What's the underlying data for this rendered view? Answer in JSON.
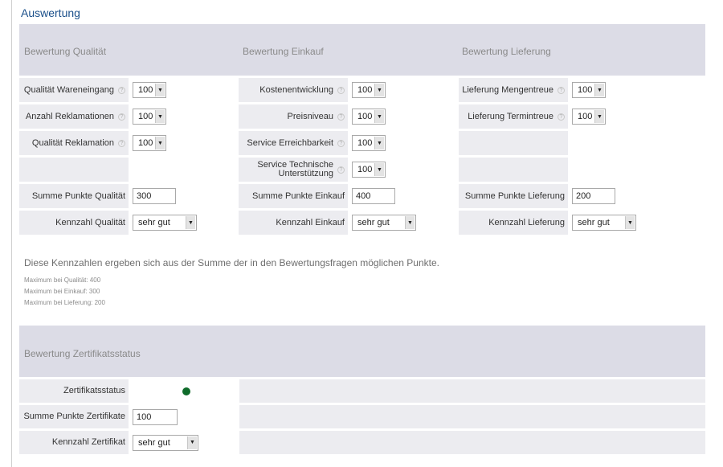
{
  "page_title": "Auswertung",
  "columns": [
    {
      "heading": "Bewertung Qualität",
      "rows": [
        {
          "label": "Qualität Wareneingang",
          "help": true,
          "value": "100"
        },
        {
          "label": "Anzahl Reklamationen",
          "help": true,
          "value": "100"
        },
        {
          "label": "Qualität Reklamation",
          "help": true,
          "value": "100"
        }
      ],
      "sum_label": "Summe Punkte Qualität",
      "sum_value": "300",
      "kpi_label": "Kennzahl Qualität",
      "kpi_value": "sehr gut"
    },
    {
      "heading": "Bewertung Einkauf",
      "rows": [
        {
          "label": "Kostenentwicklung",
          "help": true,
          "value": "100"
        },
        {
          "label": "Preisniveau",
          "help": true,
          "value": "100"
        },
        {
          "label": "Service Erreichbarkeit",
          "help": true,
          "value": "100"
        },
        {
          "label": "Service Technische\nUnterstützung",
          "help": true,
          "value": "100"
        }
      ],
      "sum_label": "Summe Punkte Einkauf",
      "sum_value": "400",
      "kpi_label": "Kennzahl Einkauf",
      "kpi_value": "sehr gut"
    },
    {
      "heading": "Bewertung Lieferung",
      "rows": [
        {
          "label": "Lieferung Mengentreue",
          "help": true,
          "value": "100"
        },
        {
          "label": "Lieferung Termintreue",
          "help": true,
          "value": "100"
        }
      ],
      "sum_label": "Summe Punkte Lieferung",
      "sum_value": "200",
      "kpi_label": "Kennzahl Lieferung",
      "kpi_value": "sehr gut"
    }
  ],
  "notes": {
    "main": "Diese Kennzahlen ergeben sich aus der Summe der in den Bewertungsfragen möglichen Punkte.",
    "max_lines": [
      "Maximum bei Qualität: 400",
      "Maximum bei Einkauf: 300",
      "Maximum bei Lieferung: 200"
    ]
  },
  "certificate": {
    "heading": "Bewertung Zertifikatsstatus",
    "status_label": "Zertifikatsstatus",
    "status_color": "#0f6b2a",
    "sum_label": "Summe Punkte Zertifikate",
    "sum_value": "100",
    "kpi_label": "Kennzahl Zertifikat",
    "kpi_value": "sehr gut"
  },
  "icons": {
    "help": "help-icon",
    "dropdown": "chevron-down-icon"
  },
  "colors": {
    "title": "#1a4f8a",
    "header_band": "#dcdce6",
    "label_cell": "#ececf0"
  }
}
